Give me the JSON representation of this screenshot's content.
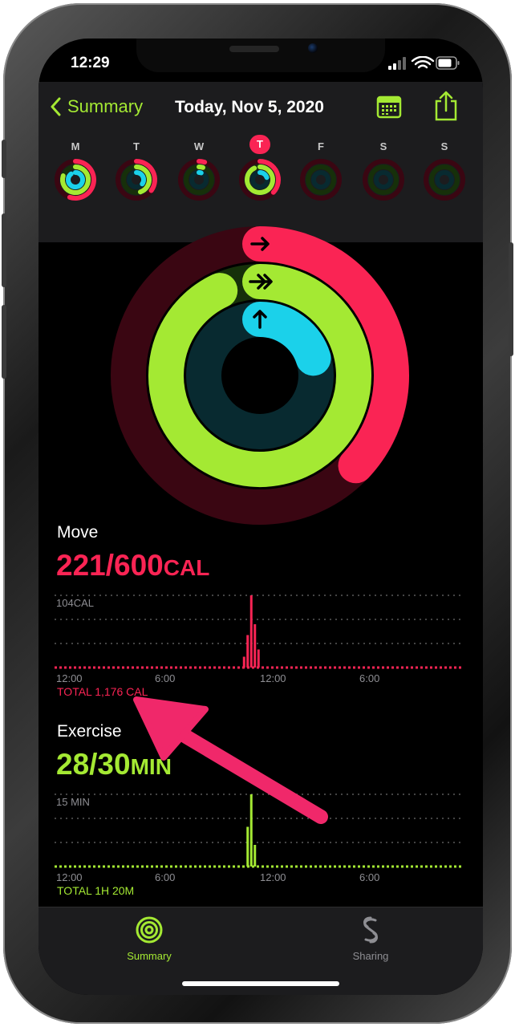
{
  "status": {
    "time": "12:29"
  },
  "nav": {
    "back_label": "Summary",
    "title": "Today, Nov 5, 2020"
  },
  "week": {
    "days": [
      {
        "letter": "M",
        "move": 0.55,
        "exercise": 0.8,
        "stand": 0.9
      },
      {
        "letter": "T",
        "move": 0.35,
        "exercise": 0.45,
        "stand": 0.35
      },
      {
        "letter": "W",
        "move": 0.05,
        "exercise": 0.05,
        "stand": 0.05
      },
      {
        "letter": "T",
        "move": 0.37,
        "exercise": 0.93,
        "stand": 0.2,
        "today": true
      },
      {
        "letter": "F",
        "move": 0,
        "exercise": 0,
        "stand": 0
      },
      {
        "letter": "S",
        "move": 0,
        "exercise": 0,
        "stand": 0
      },
      {
        "letter": "S",
        "move": 0,
        "exercise": 0,
        "stand": 0
      }
    ]
  },
  "rings": {
    "move": 0.37,
    "exercise": 0.93,
    "stand": 0.2
  },
  "move": {
    "title": "Move",
    "value": "221/600",
    "unit": "CAL",
    "max_label": "104CAL",
    "x_labels": [
      "12:00",
      "6:00",
      "12:00",
      "6:00"
    ],
    "bars": [
      0.15,
      0.45,
      1.0,
      0.6,
      0.25
    ],
    "total": "TOTAL 1,176 CAL"
  },
  "exercise": {
    "title": "Exercise",
    "value": "28/30",
    "unit": "MIN",
    "max_label": "15 MIN",
    "x_labels": [
      "12:00",
      "6:00",
      "12:00",
      "6:00"
    ],
    "bars": [
      0.55,
      1.0,
      0.3
    ],
    "total": "TOTAL 1H 20M"
  },
  "tabs": [
    {
      "label": "Summary",
      "active": true
    },
    {
      "label": "Sharing",
      "active": false
    }
  ],
  "colors": {
    "move": "#fa2454",
    "exercise": "#a4e933",
    "stand": "#1bd1ea",
    "annotation": "#f0286a"
  }
}
